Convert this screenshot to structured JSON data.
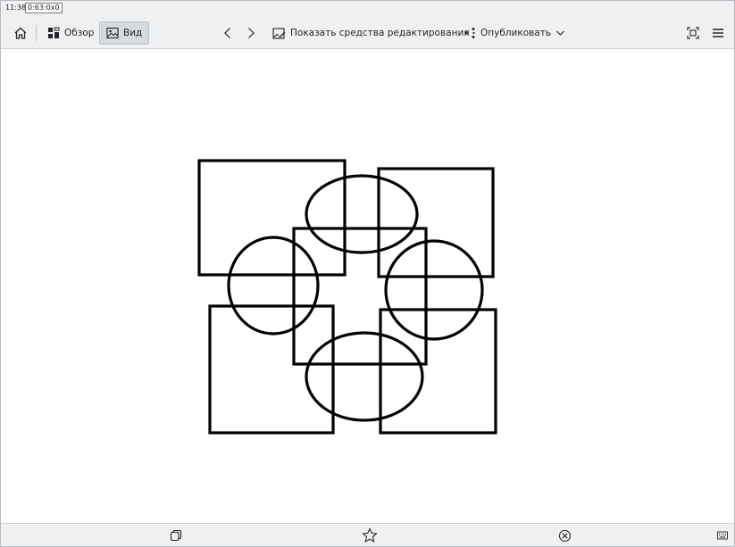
{
  "status": {
    "clock": "11:38",
    "geometry": "0:63:0x0"
  },
  "toolbar": {
    "overview_label": "Обзор",
    "view_label": "Вид",
    "edit_tools_label": "Показать средства редактирования",
    "publish_label": "Опубликовать"
  },
  "icons": {
    "home": "home-icon",
    "overview": "grid-icon",
    "view": "image-icon",
    "back": "chevron-left-icon",
    "forward": "chevron-right-icon",
    "edit_tools": "image-edit-icon",
    "publish": "share-icon",
    "publish_menu": "chevron-down-icon",
    "fullscreen": "fullscreen-icon",
    "menu": "hamburger-menu-icon",
    "copy": "copy-icon",
    "favorite": "star-icon",
    "delete": "circle-x-icon",
    "keyboard": "keyboard-icon"
  },
  "colors": {
    "toolbar_bg": "#eff0f1",
    "active_button_bg": "#d6dadf",
    "canvas_bg": "#ffffff",
    "shape_stroke": "#000000",
    "icon": "#232629"
  }
}
